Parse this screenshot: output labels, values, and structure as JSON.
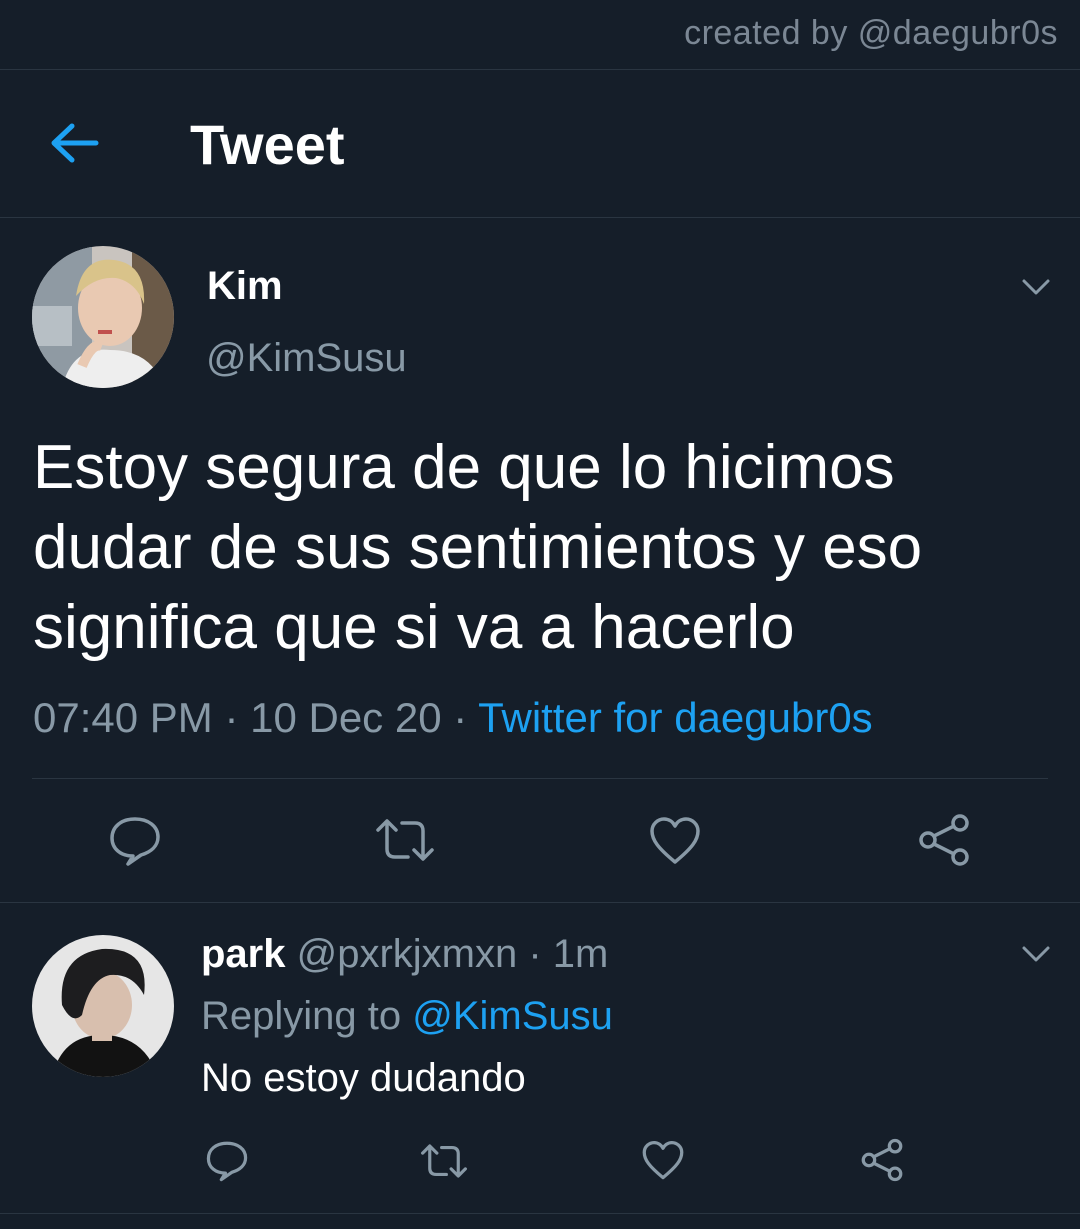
{
  "credit": "created by @daegubr0s",
  "header": {
    "title": "Tweet",
    "back_icon": "arrow-left-icon"
  },
  "tweet": {
    "name": "Kim",
    "handle": "@KimSusu",
    "text": "Estoy segura de que lo hicimos dudar de sus sentimientos y eso significa que si va a hacerlo",
    "time": "07:40 PM",
    "date": "10 Dec 20",
    "separator": " · ",
    "source": "Twitter for daegubr0s",
    "actions": [
      "reply-icon",
      "retweet-icon",
      "like-icon",
      "share-icon"
    ]
  },
  "reply": {
    "name": "park",
    "handle": "@pxrkjxmxn",
    "age": "1m",
    "separator": " · ",
    "replying_prefix": "Replying to ",
    "replying_to": "@KimSusu",
    "text": "No estoy dudando",
    "actions": [
      "reply-icon",
      "retweet-icon",
      "like-icon",
      "share-icon"
    ]
  },
  "colors": {
    "background": "#151e29",
    "accent": "#1da1f2",
    "secondary_text": "#8899a6",
    "divider": "#2a3541"
  }
}
